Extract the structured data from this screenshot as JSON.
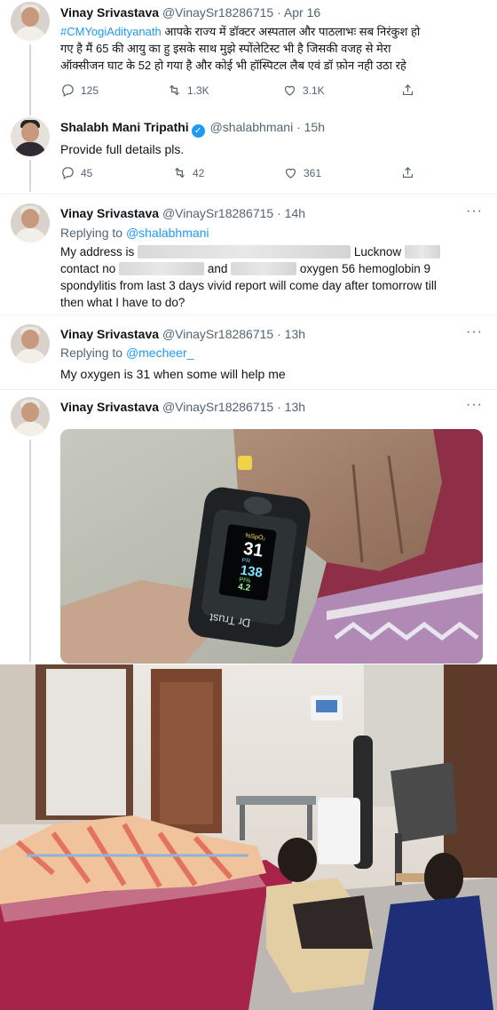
{
  "tweets": [
    {
      "name": "Vinay Srivastava",
      "handle": "@VinaySr18286715",
      "time": "· Apr 16",
      "hashtag": "#CMYogiAdityanath",
      "text_line1": " आपके राज्य में डॉक्टर अस्पताल और पाठलाभः सब निरंकुश हो",
      "text_line2": "गए है मैं 65 की आयु का हु इसके साथ मुझे स्पोंलेटिस्ट भी है जिसकी वजह से मेरा",
      "text_line3": "ऑक्सीजन घाट के 52 हो गया है और कोई भी हॉस्पिटल लैब एवं डॉ फ़ोन नही उठा रहे",
      "replies": "125",
      "retweets": "1.3K",
      "likes": "3.1K"
    },
    {
      "name": "Shalabh Mani Tripathi",
      "handle": "@shalabhmani",
      "time": "· 15h",
      "text": "Provide full details pls.",
      "replies": "45",
      "retweets": "42",
      "likes": "361"
    },
    {
      "name": "Vinay Srivastava",
      "handle": "@VinaySr18286715",
      "time": "· 14h",
      "replying_prefix": "Replying to ",
      "replying_to": "@shalabhmani",
      "line1_a": "My address is",
      "line1_b": "Lucknow",
      "line2_a": "contact no",
      "line2_b": "and",
      "line2_c": "oxygen 56 hemoglobin 9",
      "line3": "spondylitis  from last 3 days vivid report will come day after tomorrow till",
      "line4": "then what I have to do?"
    },
    {
      "name": "Vinay Srivastava",
      "handle": "@VinaySr18286715",
      "time": "· 13h",
      "replying_prefix": "Replying to ",
      "replying_to": "@mecheer_",
      "text": "My oxygen is 31 when some will help me"
    },
    {
      "name": "Vinay Srivastava",
      "handle": "@VinaySr18286715",
      "time": "· 13h"
    }
  ],
  "oximeter": {
    "spo2_label": "%SpO₂",
    "spo2": "31",
    "pr_label": "PR",
    "pr": "138",
    "pi_label": "PI%",
    "pi": "4.2",
    "brand": "Dr Trust"
  },
  "more_glyph": "···",
  "colors": {
    "link": "#1d9bf0",
    "muted": "#536471",
    "thread": "#cfd9de"
  },
  "icons": [
    "reply-icon",
    "retweet-icon",
    "like-icon",
    "share-icon",
    "more-icon",
    "verified-badge-icon"
  ]
}
